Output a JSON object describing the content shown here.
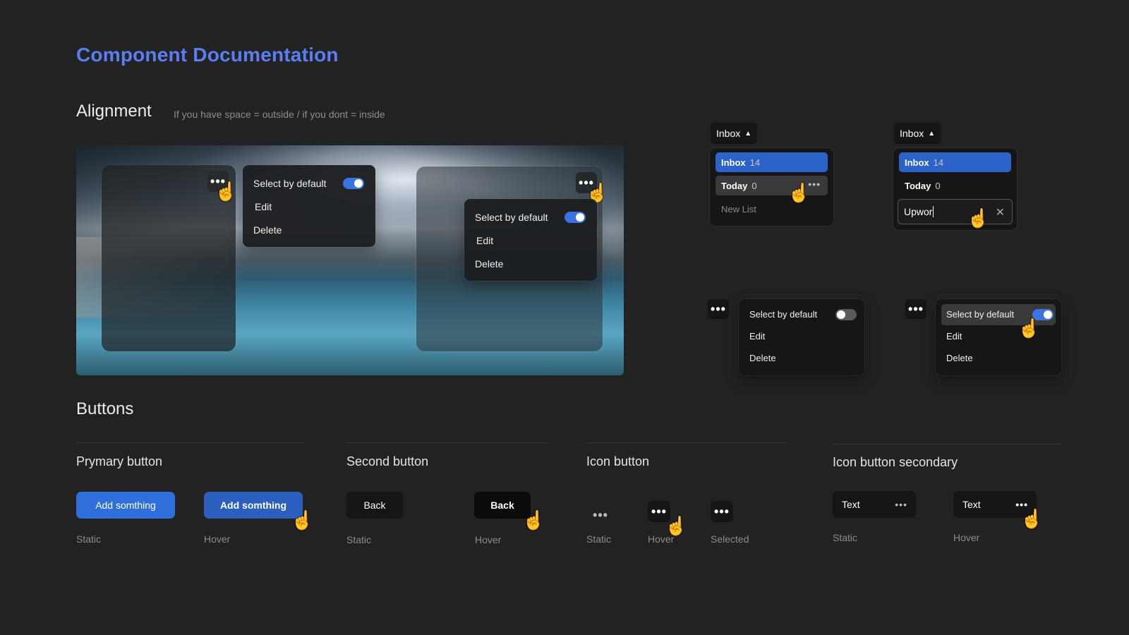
{
  "page_title": "Component Documentation",
  "alignment": {
    "heading": "Alignment",
    "note": "If you have space = outside / if you dont = inside"
  },
  "menu": {
    "select_default": "Select by default",
    "edit": "Edit",
    "delete": "Delete"
  },
  "inbox_a": {
    "trigger": "Inbox",
    "items": [
      {
        "label": "Inbox",
        "count": "14"
      },
      {
        "label": "Today",
        "count": "0"
      },
      {
        "label": "New List",
        "count": ""
      }
    ]
  },
  "inbox_b": {
    "trigger": "Inbox",
    "items": [
      {
        "label": "Inbox",
        "count": "14"
      },
      {
        "label": "Today",
        "count": "0"
      }
    ],
    "input_value": "Upwor"
  },
  "buttons": {
    "heading": "Buttons",
    "primary": {
      "title": "Prymary button",
      "label": "Add somthing",
      "static": "Static",
      "hover": "Hover"
    },
    "second": {
      "title": "Second button",
      "label": "Back",
      "static": "Static",
      "hover": "Hover"
    },
    "icon": {
      "title": "Icon button",
      "static": "Static",
      "hover": "Hover",
      "selected": "Selected"
    },
    "icon_secondary": {
      "title": "Icon button secondary",
      "label": "Text",
      "static": "Static",
      "hover": "Hover"
    }
  },
  "colors": {
    "accent": "#5b7ff2",
    "primary_button": "#2f6fdb",
    "selected_row": "#2d63c8",
    "background": "#222222"
  },
  "icons": [
    "more-dots-icon",
    "caret-up-icon",
    "close-icon",
    "pointer-hand-icon",
    "toggle-switch"
  ]
}
